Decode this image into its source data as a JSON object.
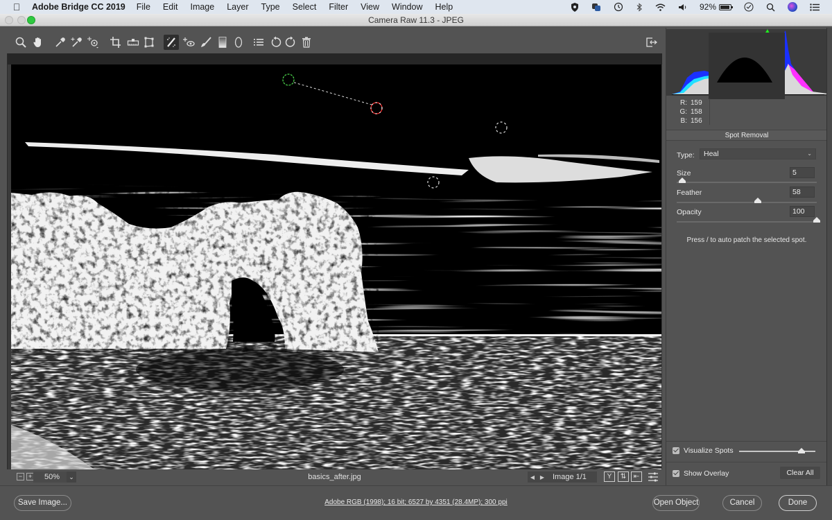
{
  "menubar": {
    "app_name": "Adobe Bridge CC 2019",
    "items": [
      "File",
      "Edit",
      "Image",
      "Layer",
      "Type",
      "Select",
      "Filter",
      "View",
      "Window",
      "Help"
    ],
    "status_icons": [
      "shield-icon",
      "creative-cloud-icon",
      "time-machine-icon",
      "bluetooth-icon",
      "wifi-icon",
      "volume-icon"
    ],
    "battery_percent": "92%",
    "right_icons": [
      "clock-icon",
      "spotlight-search-icon",
      "siri-icon",
      "notification-center-icon"
    ]
  },
  "window": {
    "title": "Camera Raw 11.3  -  JPEG"
  },
  "toolbar": {
    "tools": [
      {
        "name": "zoom-tool",
        "icon": "magnifier-icon",
        "active": false
      },
      {
        "name": "hand-tool",
        "icon": "hand-icon",
        "active": false
      },
      {
        "name": "white-balance-tool",
        "icon": "eyedropper-icon",
        "active": false
      },
      {
        "name": "color-sampler-tool",
        "icon": "eyedropper-sparkle-icon",
        "active": false
      },
      {
        "name": "targeted-adjustment-tool",
        "icon": "target-adjust-icon",
        "active": false
      },
      {
        "name": "crop-tool",
        "icon": "crop-icon",
        "active": false
      },
      {
        "name": "straighten-tool",
        "icon": "level-icon",
        "active": false
      },
      {
        "name": "transform-tool",
        "icon": "transform-icon",
        "active": false
      },
      {
        "name": "spot-removal-tool",
        "icon": "spot-removal-brush-icon",
        "active": true
      },
      {
        "name": "red-eye-tool",
        "icon": "red-eye-icon",
        "active": false
      },
      {
        "name": "adjustment-brush-tool",
        "icon": "brush-icon",
        "active": false
      },
      {
        "name": "graduated-filter-tool",
        "icon": "gradient-icon",
        "active": false
      },
      {
        "name": "radial-filter-tool",
        "icon": "ellipse-icon",
        "active": false
      },
      {
        "name": "preferences",
        "icon": "list-icon",
        "active": false
      },
      {
        "name": "rotate-ccw",
        "icon": "rotate-left-icon",
        "active": false
      },
      {
        "name": "rotate-cw",
        "icon": "rotate-right-icon",
        "active": false
      },
      {
        "name": "delete",
        "icon": "trash-icon",
        "active": false
      }
    ],
    "fullscreen_icon": "toggle-fullscreen-icon"
  },
  "canvas": {
    "zoom_level": "50%",
    "filename": "basics_after.jpg",
    "image_counter": "Image 1/1",
    "view_buttons": [
      "before-after-toggle-icon",
      "swap-settings-icon",
      "copy-settings-icon",
      "preview-preferences-icon"
    ]
  },
  "histogram": {
    "r": "159",
    "g": "158",
    "b": "156",
    "labels": {
      "r": "R:",
      "g": "G:",
      "b": "B:"
    }
  },
  "spot_removal": {
    "title": "Spot Removal",
    "type_label": "Type:",
    "type_value": "Heal",
    "sliders": [
      {
        "label": "Size",
        "value": "5",
        "fraction": 0.04
      },
      {
        "label": "Feather",
        "value": "58",
        "fraction": 0.58
      },
      {
        "label": "Opacity",
        "value": "100",
        "fraction": 1.0
      }
    ],
    "hint": "Press / to auto patch the selected spot.",
    "visualize_spots_label": "Visualize Spots",
    "visualize_spots_checked": true,
    "visualize_threshold_fraction": 0.82,
    "show_overlay_label": "Show Overlay",
    "show_overlay_checked": true,
    "clear_all_label": "Clear All"
  },
  "footer": {
    "save_label": "Save Image...",
    "info": "Adobe RGB (1998); 16 bit; 6527 by 4351 (28.4MP); 300 ppi",
    "open_object_label": "Open Object",
    "cancel_label": "Cancel",
    "done_label": "Done"
  }
}
